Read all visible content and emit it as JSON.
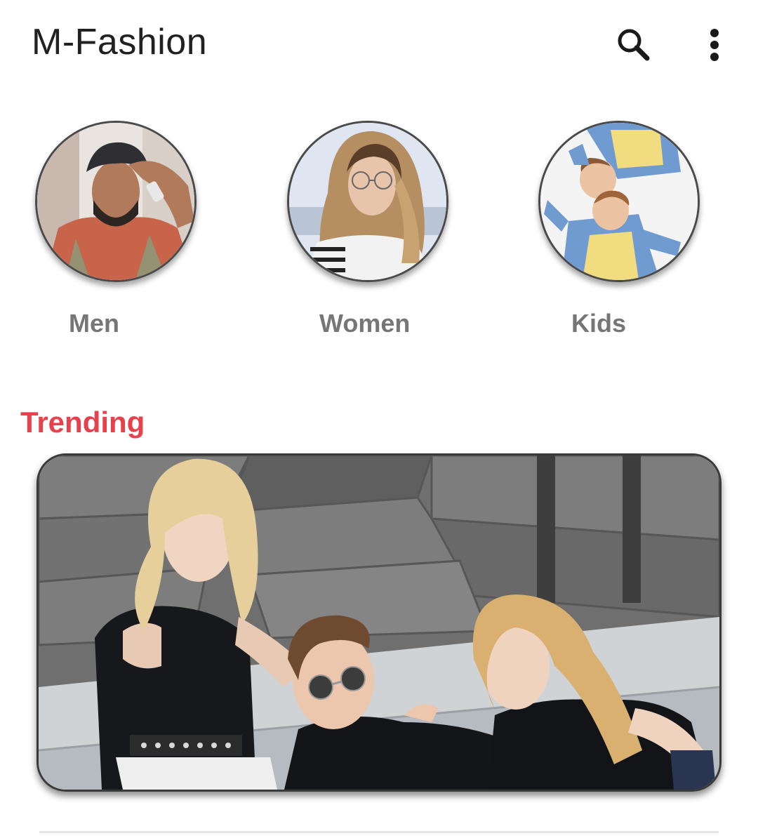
{
  "app_bar": {
    "title": "M-Fashion",
    "icons": [
      "search-icon",
      "more-vert-icon"
    ]
  },
  "categories": [
    {
      "label": "Men"
    },
    {
      "label": "Women"
    },
    {
      "label": "Kids"
    }
  ],
  "trending": {
    "title": "Trending"
  },
  "colors": {
    "accent": "#e8414b",
    "title_text": "#212121",
    "category_text": "#767676"
  }
}
